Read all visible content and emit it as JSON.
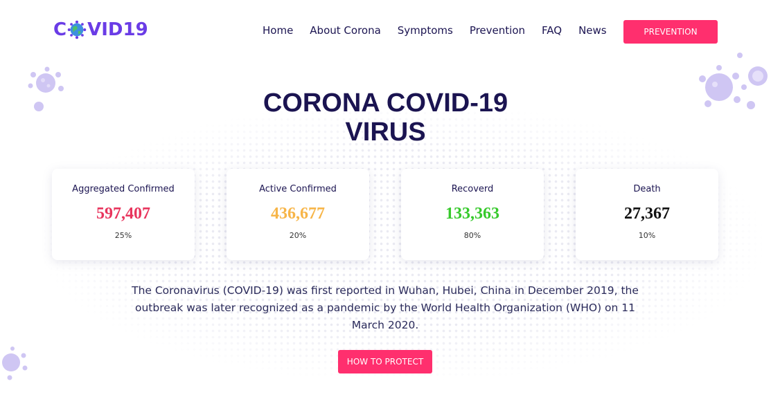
{
  "logo": {
    "text_prefix": "C",
    "text_suffix": "VID19"
  },
  "nav": {
    "items": [
      {
        "label": "Home"
      },
      {
        "label": "About Corona"
      },
      {
        "label": "Symptoms"
      },
      {
        "label": "Prevention"
      },
      {
        "label": "FAQ"
      },
      {
        "label": "News"
      }
    ],
    "cta_label": "PREVENTION"
  },
  "hero": {
    "title_line1": "CORONA COVID-19",
    "title_line2": "VIRUS"
  },
  "stats": [
    {
      "label": "Aggregated Confirmed",
      "value": "597,407",
      "percent": "25%",
      "color": "#e8355d"
    },
    {
      "label": "Active Confirmed",
      "value": "436,677",
      "percent": "20%",
      "color": "#f7b548"
    },
    {
      "label": "Recoverd",
      "value": "133,363",
      "percent": "80%",
      "color": "#36c92b"
    },
    {
      "label": "Death",
      "value": "27,367",
      "percent": "10%",
      "color": "#111111"
    }
  ],
  "description": "The Coronavirus (COVID-19) was first reported in Wuhan, Hubei, China in December 2019, the outbreak was later recognized as a pandemic by the World Health Organization (WHO) on 11 March 2020.",
  "cta": {
    "label": "HOW TO PROTECT"
  },
  "colors": {
    "brand": "#6a3ce6",
    "accent": "#ff2f6e",
    "text": "#1b1451",
    "virus": "#c9bff2"
  },
  "icons": {
    "logo_globe": "virus-globe-icon",
    "decor": "virus-icon"
  }
}
